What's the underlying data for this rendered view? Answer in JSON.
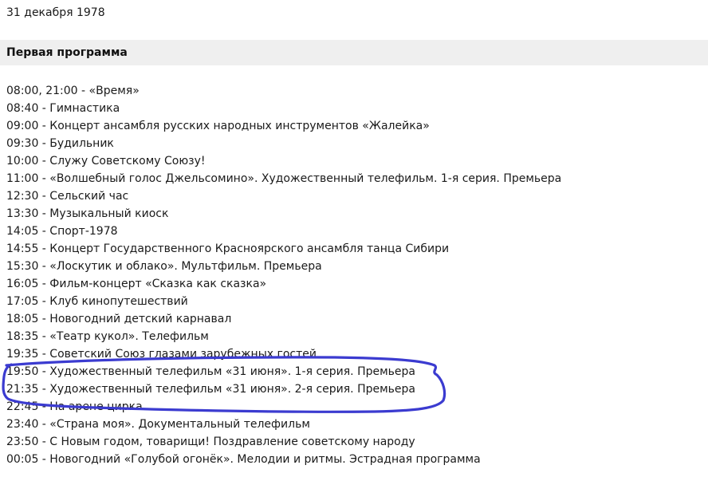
{
  "date": "31 декабря 1978",
  "channel": {
    "title": "Первая программа"
  },
  "schedule": [
    "08:00, 21:00 - «Время»",
    "08:40 - Гимнастика",
    "09:00 - Концерт ансамбля русских народных инструментов «Жалейка»",
    "09:30 - Будильник",
    "10:00 - Служу Советскому Союзу!",
    "11:00 - «Волшебный голос Джельсомино». Художественный телефильм. 1-я серия. Премьера",
    "12:30 - Сельский час",
    "13:30 - Музыкальный киоск",
    "14:05 - Спорт-1978",
    "14:55 - Концерт Государственного Красноярского ансамбля танца Сибири",
    "15:30 - «Лоскутик и облако». Мультфильм. Премьера",
    "16:05 - Фильм-концерт «Сказка как сказка»",
    "17:05 - Клуб кинопутешествий",
    "18:05 - Новогодний детский карнавал",
    "18:35 - «Театр кукол». Телефильм",
    "19:35 - Советский Союз глазами зарубежных гостей",
    "19:50 - Художественный телефильм «31 июня». 1-я серия. Премьера",
    "21:35 - Художественный телефильм «31 июня». 2-я серия. Премьера",
    "22:45 - На арене цирка",
    "23:40 - «Страна моя». Документальный телефильм",
    "23:50 - С Новым годом, товарищи! Поздравление советскому народу",
    "00:05 - Новогодний «Голубой огонёк». Мелодии и ритмы. Эстрадная программа"
  ],
  "colors": {
    "highlight_stroke": "#3b3bd0",
    "channel_bar": "#efefef"
  }
}
